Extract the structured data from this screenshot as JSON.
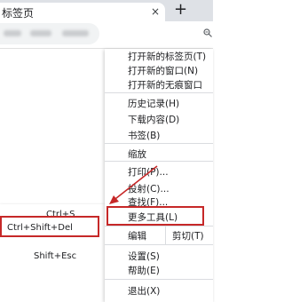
{
  "tab": {
    "title": "标签页",
    "close": "×"
  },
  "newtab": {
    "label": "+"
  },
  "shortcuts": [
    {
      "key": "Ctrl+S"
    },
    {
      "key": "Ctrl+Shift+Del"
    },
    {
      "key": "Shift+Esc"
    }
  ],
  "menu": {
    "new_tab": "打开新的标签页(T)",
    "new_window": "打开新的窗口(N)",
    "incognito": "打开新的无痕窗口",
    "history": "历史记录(H)",
    "downloads": "下载内容(D)",
    "bookmarks": "书签(B)",
    "zoom": "缩放",
    "print": "打印(P)...",
    "cast": "投射(C)...",
    "find": "查找(F)...",
    "more_tools": "更多工具(L)",
    "edit": "编辑",
    "cut": "剪切(T)",
    "settings": "设置(S)",
    "help": "帮助(E)",
    "exit": "退出(X)"
  },
  "colors": {
    "highlight_border": "#c62828",
    "arrow": "#c62828"
  }
}
